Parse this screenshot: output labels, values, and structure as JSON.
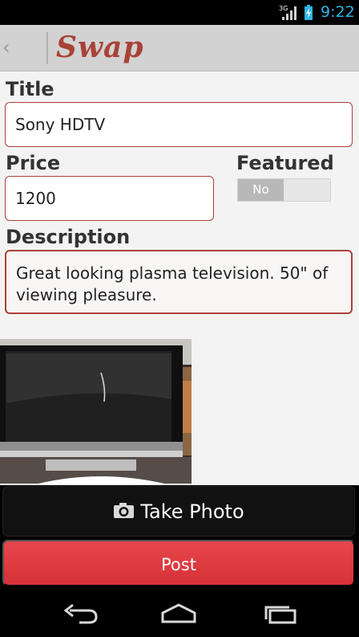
{
  "status_bar": {
    "network": "3G",
    "time": "9:22"
  },
  "app_bar": {
    "logo": "Swap"
  },
  "form": {
    "title_label": "Title",
    "title_value": "Sony HDTV",
    "price_label": "Price",
    "price_value": "1200",
    "featured_label": "Featured",
    "featured_toggle": "No",
    "description_label": "Description",
    "description_value": "Great looking plasma television. 50\" of viewing pleasure."
  },
  "actions": {
    "take_photo_label": "Take Photo",
    "post_label": "Post"
  },
  "colors": {
    "accent": "#a94238",
    "post": "#d73138",
    "clock": "#33b5e5"
  }
}
